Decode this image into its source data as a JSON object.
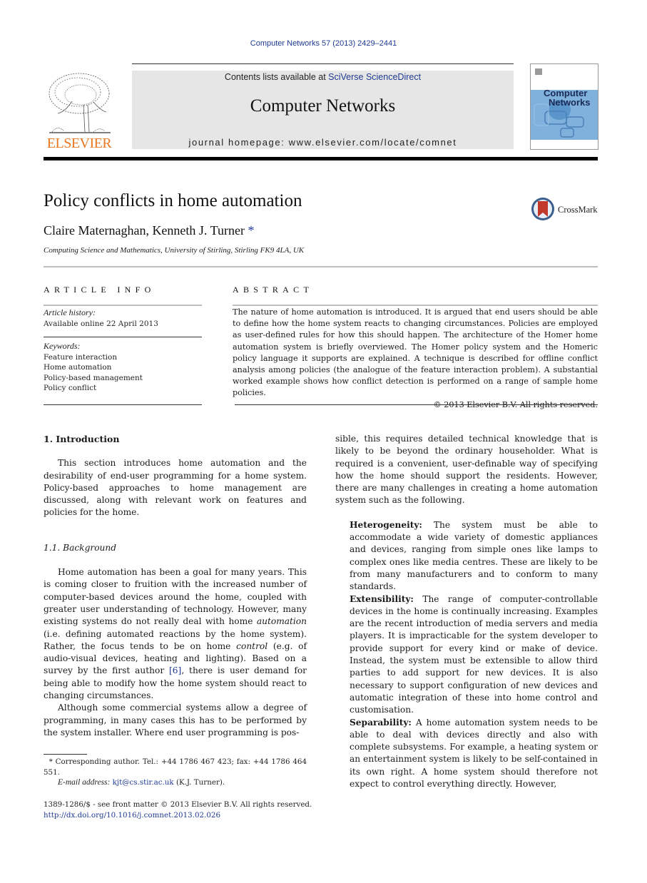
{
  "header": {
    "citation": "Computer Networks 57 (2013) 2429–2441",
    "publisher_logo_text": "ELSEVIER",
    "contents_prefix": "Contents lists available at ",
    "contents_link": "SciVerse ScienceDirect",
    "journal_title": "Computer Networks",
    "homepage": "journal homepage: www.elsevier.com/locate/comnet",
    "cover_title_line1": "Computer",
    "cover_title_line2": "Networks"
  },
  "article": {
    "title": "Policy conflicts in home automation",
    "crossmark_label": "CrossMark",
    "authors": "Claire Maternaghan, Kenneth J. Turner",
    "author_marker": "*",
    "affiliation": "Computing Science and Mathematics, University of Stirling, Stirling FK9 4LA, UK"
  },
  "article_info": {
    "heading": "ARTICLE INFO",
    "history_label": "Article history:",
    "history_value": "Available online 22 April 2013",
    "keywords_label": "Keywords:",
    "keywords": [
      "Feature interaction",
      "Home automation",
      "Policy-based management",
      "Policy conflict"
    ]
  },
  "abstract": {
    "heading": "ABSTRACT",
    "text": "The nature of home automation is introduced. It is argued that end users should be able to define how the home system reacts to changing circumstances. Policies are employed as user-defined rules for how this should happen. The architecture of the Homer home automation system is briefly overviewed. The Homer policy system and the Homeric policy language it supports are explained. A technique is described for offline conflict analysis among policies (the analogue of the feature interaction problem). A substantial worked example shows how conflict detection is performed on a range of sample home policies.",
    "copyright": "© 2013 Elsevier B.V. All rights reserved."
  },
  "body": {
    "section1_heading": "1. Introduction",
    "section1_intro": "This section introduces home automation and the desirability of end-user programming for a home system. Policy-based approaches to home management are discussed, along with relevant work on features and policies for the home.",
    "subsection_heading": "1.1. Background",
    "bg_p1_a": "Home automation has been a goal for many years. This is coming closer to fruition with the increased number of computer-based devices around the home, coupled with greater user understanding of technology. However, many existing systems do not really deal with home ",
    "bg_p1_em1": "automation",
    "bg_p1_b": " (i.e. defining automated reactions by the home system). Rather, the focus tends to be on home ",
    "bg_p1_em2": "control",
    "bg_p1_c": " (e.g. of audio-visual devices, heating and lighting). Based on a survey by the first author ",
    "bg_p1_ref": "[6]",
    "bg_p1_d": ", there is user demand for being able to modify how the home system should react to changing circumstances.",
    "bg_p2": "Although some commercial systems allow a degree of programming, in many cases this has to be performed by the system installer. Where end user programming is possible, this requires detailed technical knowledge that is likely to be beyond the ordinary householder. What is required is a convenient, user-definable way of specifying how the home should support the residents. However, there are many challenges in creating a home automation system such as the following.",
    "challenges": [
      {
        "term": "Heterogeneity:",
        "text": " The system must be able to accommodate a wide variety of domestic appliances and devices, ranging from simple ones like lamps to complex ones like media centres. These are likely to be from many manufacturers and to conform to many standards."
      },
      {
        "term": "Extensibility:",
        "text": " The range of computer-controllable devices in the home is continually increasing. Examples are the recent introduction of media servers and media players. It is impracticable for the system developer to provide support for every kind or make of device. Instead, the system must be extensible to allow third parties to add support for new devices. It is also necessary to support configuration of new devices and automatic integration of these into home control and customisation."
      },
      {
        "term": "Separability:",
        "text": " A home automation system needs to be able to deal with devices directly and also with complete subsystems. For example, a heating system or an entertainment system is likely to be self-contained in its own right. A home system should therefore not expect to control everything directly. However,"
      }
    ]
  },
  "footnote": {
    "marker": "*",
    "text": " Corresponding author. Tel.: +44 1786 467 423; fax: +44 1786 464 551.",
    "email_label": "E-mail address:",
    "email": "kjt@cs.stir.ac.uk",
    "email_suffix": " (K.J. Turner)."
  },
  "front_matter": {
    "issn_line": "1389-1286/$ - see front matter © 2013 Elsevier B.V. All rights reserved.",
    "doi": "http://dx.doi.org/10.1016/j.comnet.2013.02.026"
  }
}
